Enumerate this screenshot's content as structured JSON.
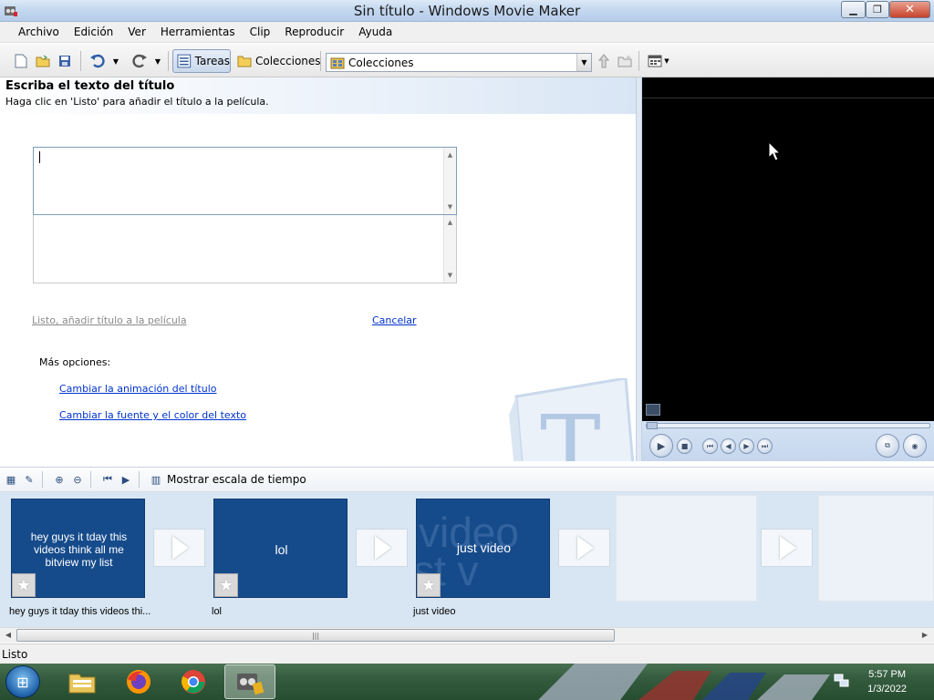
{
  "window": {
    "title": "Sin título - Windows Movie Maker"
  },
  "menu": [
    "Archivo",
    "Edición",
    "Ver",
    "Herramientas",
    "Clip",
    "Reproducir",
    "Ayuda"
  ],
  "toolbar": {
    "tareas_label": "Tareas",
    "colecciones_label": "Colecciones",
    "collection_select": "Colecciones"
  },
  "task_pane": {
    "title": "Escriba el texto del título",
    "subtitle": "Haga clic en 'Listo' para añadir el título a la película.",
    "title_text_value": "",
    "listo_link": "Listo, añadir título a la película",
    "cancel_link": "Cancelar",
    "more_options_label": "Más opciones:",
    "change_animation_link": "Cambiar la animación del título",
    "change_font_link": "Cambiar la fuente y el color del texto"
  },
  "storyboard_toolbar": {
    "timeline_label": "Mostrar escala de tiempo"
  },
  "clips": [
    {
      "thumb_text": "hey guys it tday this videos think all me bitview my list",
      "label": "hey guys it tday this videos thi..."
    },
    {
      "thumb_text": "lol",
      "label": "lol"
    },
    {
      "thumb_text": "just video",
      "label": "just video",
      "bg_text": [
        "video",
        "st v"
      ]
    }
  ],
  "status": {
    "text": "Listo"
  },
  "taskbar": {
    "time": "5:57 PM",
    "date": "1/3/2022"
  },
  "colors": {
    "clip_bg": "#164b8b",
    "link": "#0033cc",
    "storyboard_bg": "#d8e6f3"
  }
}
